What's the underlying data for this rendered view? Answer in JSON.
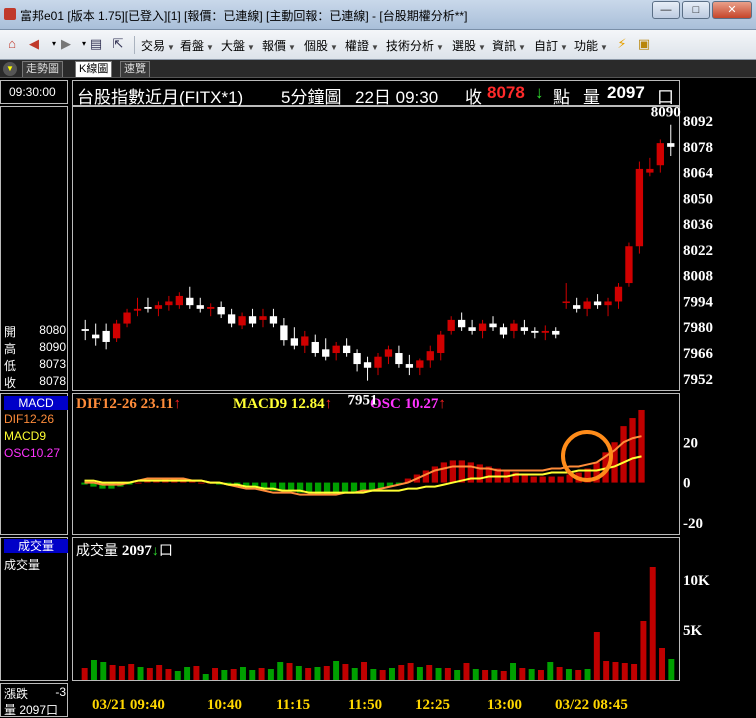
{
  "window": {
    "title": "富邦e01 [版本 1.75][已登入][1] [報價：已連線] [主動回報：已連線] - [台股期權分析**]",
    "minimize": "—",
    "maximize": "□",
    "close": "✕"
  },
  "menubar": {
    "items": [
      "交易",
      "看盤",
      "大盤",
      "報價",
      "個股",
      "權證",
      "技術分析",
      "選股",
      "資訊",
      "自訂",
      "功能"
    ]
  },
  "tabs": [
    "走勢圖",
    "K線圖",
    "速覽"
  ],
  "left": {
    "time": "09:30:00",
    "ohlc": [
      {
        "label": "開",
        "value": "8080"
      },
      {
        "label": "高",
        "value": "8090"
      },
      {
        "label": "低",
        "value": "8073"
      },
      {
        "label": "收",
        "value": "8078"
      }
    ],
    "macd_box": "MACD",
    "macd_dif": "DIF12-26",
    "macd_macd9": "MACD9",
    "macd_osc": "OSC10.27",
    "vol_box": "成交量",
    "vol_label": "成交量",
    "bottom_change_label": "漲跌",
    "bottom_change_value": "-3",
    "bottom_volume": "量 2097口"
  },
  "header": {
    "instrument": "台股指數近月(FITX*1)",
    "period": "5分鐘圖",
    "date_time": "22日 09:30",
    "close_label": "收",
    "close_value": "8078",
    "unit": "點",
    "volume_label": "量",
    "volume_value": "2097",
    "volume_unit": "口"
  },
  "indicators": {
    "dif": "DIF12-26 23.11",
    "macd": "MACD9 12.84",
    "osc": "OSC 10.27",
    "volume_title": "成交量",
    "volume_value": "2097",
    "volume_unit": "口"
  },
  "annotations": {
    "high": "8090",
    "low": "7951"
  },
  "colors": {
    "up": "#d00000",
    "down": "#ffffff",
    "dif": "#ff8c3a",
    "macd9": "#ffff33",
    "osc": "#ff33ff",
    "volume_up": "#c00000",
    "volume_down": "#00a000",
    "highlight_circle": "#ff8c1a"
  },
  "chart_data": [
    {
      "type": "candlestick",
      "yticks": [
        8092,
        8078,
        8064,
        8050,
        8036,
        8022,
        8008,
        7994,
        7980,
        7966,
        7952
      ],
      "ylim": [
        7947,
        8098
      ],
      "xticks": [
        "03/21 09:40",
        "10:40",
        "11:15",
        "11:50",
        "12:25",
        "13:00",
        "03/22 08:45"
      ],
      "candles": [
        [
          7979,
          7984,
          7973,
          7978
        ],
        [
          7976,
          7982,
          7970,
          7974
        ],
        [
          7978,
          7982,
          7968,
          7972
        ],
        [
          7974,
          7984,
          7972,
          7982
        ],
        [
          7982,
          7990,
          7980,
          7988
        ],
        [
          7989,
          7996,
          7986,
          7990
        ],
        [
          7991,
          7996,
          7988,
          7990
        ],
        [
          7990,
          7994,
          7986,
          7992
        ],
        [
          7992,
          7997,
          7989,
          7994
        ],
        [
          7992,
          7999,
          7990,
          7997
        ],
        [
          7996,
          8002,
          7990,
          7992
        ],
        [
          7992,
          7996,
          7988,
          7990
        ],
        [
          7990,
          7993,
          7986,
          7991
        ],
        [
          7991,
          7994,
          7985,
          7987
        ],
        [
          7987,
          7990,
          7980,
          7982
        ],
        [
          7981,
          7988,
          7979,
          7986
        ],
        [
          7986,
          7990,
          7980,
          7982
        ],
        [
          7984,
          7990,
          7980,
          7986
        ],
        [
          7986,
          7990,
          7980,
          7982
        ],
        [
          7981,
          7985,
          7970,
          7973
        ],
        [
          7974,
          7980,
          7968,
          7970
        ],
        [
          7970,
          7978,
          7966,
          7975
        ],
        [
          7972,
          7976,
          7964,
          7966
        ],
        [
          7968,
          7974,
          7962,
          7964
        ],
        [
          7966,
          7972,
          7962,
          7970
        ],
        [
          7970,
          7974,
          7964,
          7966
        ],
        [
          7966,
          7968,
          7956,
          7960
        ],
        [
          7961,
          7964,
          7951,
          7958
        ],
        [
          7958,
          7966,
          7954,
          7964
        ],
        [
          7964,
          7970,
          7960,
          7968
        ],
        [
          7966,
          7970,
          7958,
          7960
        ],
        [
          7960,
          7965,
          7954,
          7958
        ],
        [
          7958,
          7963,
          7954,
          7962
        ],
        [
          7962,
          7970,
          7958,
          7967
        ],
        [
          7966,
          7978,
          7962,
          7976
        ],
        [
          7978,
          7986,
          7976,
          7984
        ],
        [
          7984,
          7988,
          7978,
          7980
        ],
        [
          7980,
          7984,
          7976,
          7978
        ],
        [
          7978,
          7984,
          7974,
          7982
        ],
        [
          7982,
          7986,
          7978,
          7980
        ],
        [
          7980,
          7982,
          7974,
          7976
        ],
        [
          7978,
          7984,
          7974,
          7982
        ],
        [
          7980,
          7984,
          7976,
          7978
        ],
        [
          7978,
          7980,
          7974,
          7977
        ],
        [
          7977,
          7981,
          7973,
          7978
        ],
        [
          7978,
          7980,
          7974,
          7976
        ],
        [
          7994,
          8004,
          7990,
          7994
        ],
        [
          7992,
          7996,
          7988,
          7990
        ],
        [
          7990,
          7996,
          7986,
          7994
        ],
        [
          7994,
          7998,
          7990,
          7992
        ],
        [
          7992,
          7996,
          7986,
          7994
        ],
        [
          7994,
          8004,
          7990,
          8002
        ],
        [
          8004,
          8026,
          8002,
          8024
        ],
        [
          8024,
          8070,
          8020,
          8066
        ],
        [
          8064,
          8072,
          8062,
          8066
        ],
        [
          8068,
          8082,
          8064,
          8080
        ],
        [
          8080,
          8090,
          8073,
          8078
        ]
      ]
    },
    {
      "type": "bar",
      "title": "MACD",
      "yticks": [
        20,
        0,
        -20
      ],
      "ylim": [
        -25,
        35
      ],
      "osc_values": [
        -1,
        -2,
        -3,
        -3,
        -2,
        -1,
        0,
        1,
        1,
        2,
        2,
        2,
        1,
        0,
        0,
        -1,
        -1,
        -1,
        -2,
        -2,
        -3,
        -4,
        -4,
        -4,
        -5,
        -5,
        -6,
        -6,
        -6,
        -5,
        -5,
        -4,
        -4,
        -3,
        -2,
        -1,
        2,
        4,
        6,
        8,
        10,
        11,
        11,
        10,
        9,
        8,
        7,
        6,
        5,
        4,
        3,
        3,
        3,
        3,
        4,
        5,
        7,
        10,
        15,
        20,
        28,
        32,
        36
      ],
      "dif_values": [
        0,
        0,
        -1,
        -1,
        -1,
        0,
        1,
        2,
        2,
        2,
        2,
        2,
        1,
        1,
        0,
        0,
        -1,
        -2,
        -3,
        -3,
        -4,
        -5,
        -5,
        -5,
        -6,
        -6,
        -6,
        -6,
        -6,
        -5,
        -5,
        -4,
        -4,
        -3,
        -2,
        -1,
        0,
        2,
        4,
        6,
        7,
        8,
        8,
        8,
        7,
        7,
        6,
        6,
        6,
        6,
        6,
        6,
        7,
        7,
        8,
        8,
        9,
        10,
        13,
        16,
        20,
        22,
        23
      ],
      "macd9_values": [
        1,
        1,
        0,
        0,
        0,
        0,
        1,
        1,
        1,
        1,
        1,
        1,
        1,
        1,
        0,
        0,
        -1,
        -1,
        -2,
        -2,
        -3,
        -3,
        -4,
        -4,
        -4,
        -5,
        -5,
        -5,
        -5,
        -5,
        -5,
        -5,
        -4,
        -4,
        -4,
        -4,
        -3,
        -3,
        -2,
        -2,
        -1,
        0,
        1,
        2,
        2,
        3,
        3,
        3,
        4,
        4,
        4,
        4,
        5,
        5,
        5,
        6,
        6,
        6,
        7,
        8,
        10,
        12,
        13
      ]
    },
    {
      "type": "bar",
      "title": "成交量",
      "yticks": [
        "10K",
        "5K"
      ],
      "ylim": [
        0,
        12000
      ],
      "values": [
        1200,
        2000,
        1800,
        1500,
        1400,
        1600,
        1300,
        1200,
        1500,
        1100,
        900,
        1300,
        1400,
        600,
        1200,
        1000,
        1100,
        1300,
        1000,
        1200,
        1100,
        1800,
        1700,
        1400,
        1200,
        1300,
        1400,
        1900,
        1600,
        1200,
        1800,
        1100,
        1000,
        1200,
        1500,
        1700,
        1300,
        1500,
        1200,
        1200,
        1000,
        1700,
        1100,
        1000,
        1000,
        900,
        1700,
        1200,
        1100,
        1000,
        1800,
        1300,
        1100,
        1000,
        1100,
        4800,
        1900,
        1800,
        1700,
        1600,
        5900,
        11300,
        3200,
        2100
      ],
      "up": [
        1,
        0,
        0,
        1,
        1,
        1,
        0,
        1,
        1,
        1,
        0,
        0,
        1,
        0,
        1,
        0,
        1,
        0,
        0,
        1,
        0,
        0,
        1,
        0,
        1,
        0,
        1,
        0,
        1,
        0,
        1,
        0,
        1,
        0,
        1,
        1,
        0,
        1,
        0,
        1,
        0,
        1,
        0,
        1,
        0,
        1,
        0,
        1,
        0,
        1,
        0,
        1,
        0,
        1,
        0,
        1,
        1,
        1,
        1,
        1,
        1,
        1,
        1,
        0
      ]
    }
  ]
}
